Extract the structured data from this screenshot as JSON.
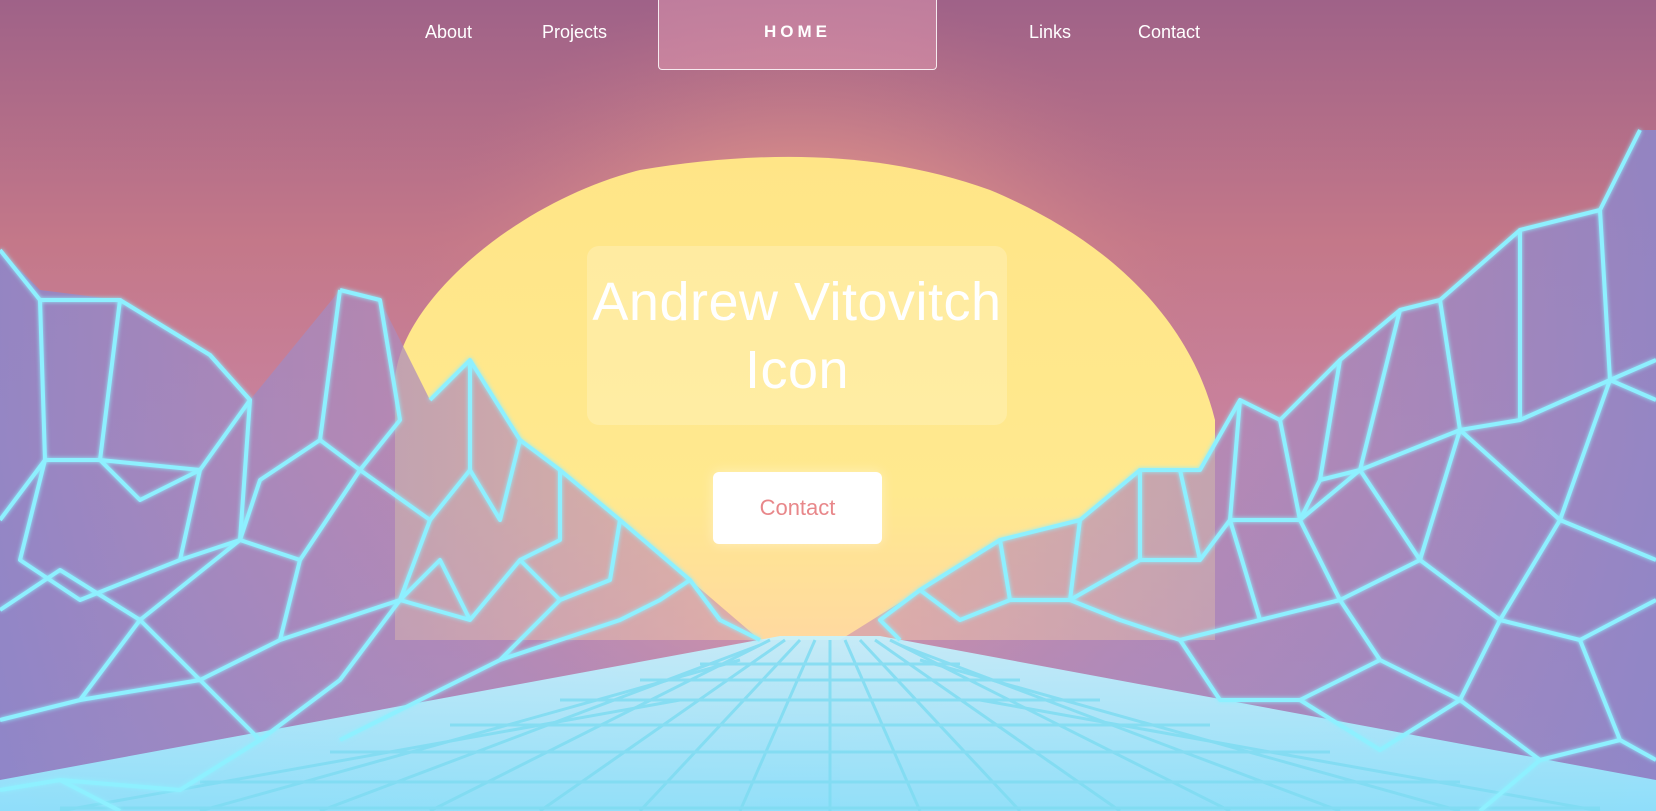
{
  "nav": {
    "about": "About",
    "projects": "Projects",
    "home": "HOME",
    "links": "Links",
    "contact": "Contact"
  },
  "hero": {
    "title_line1": "Andrew Vitovitch",
    "title_line2": "Icon",
    "contact_button": "Contact"
  },
  "colors": {
    "sky_top": "#9f6288",
    "sun": "#fde68a",
    "neon_wire": "#8ef0ff",
    "button_text": "#e8878a"
  }
}
